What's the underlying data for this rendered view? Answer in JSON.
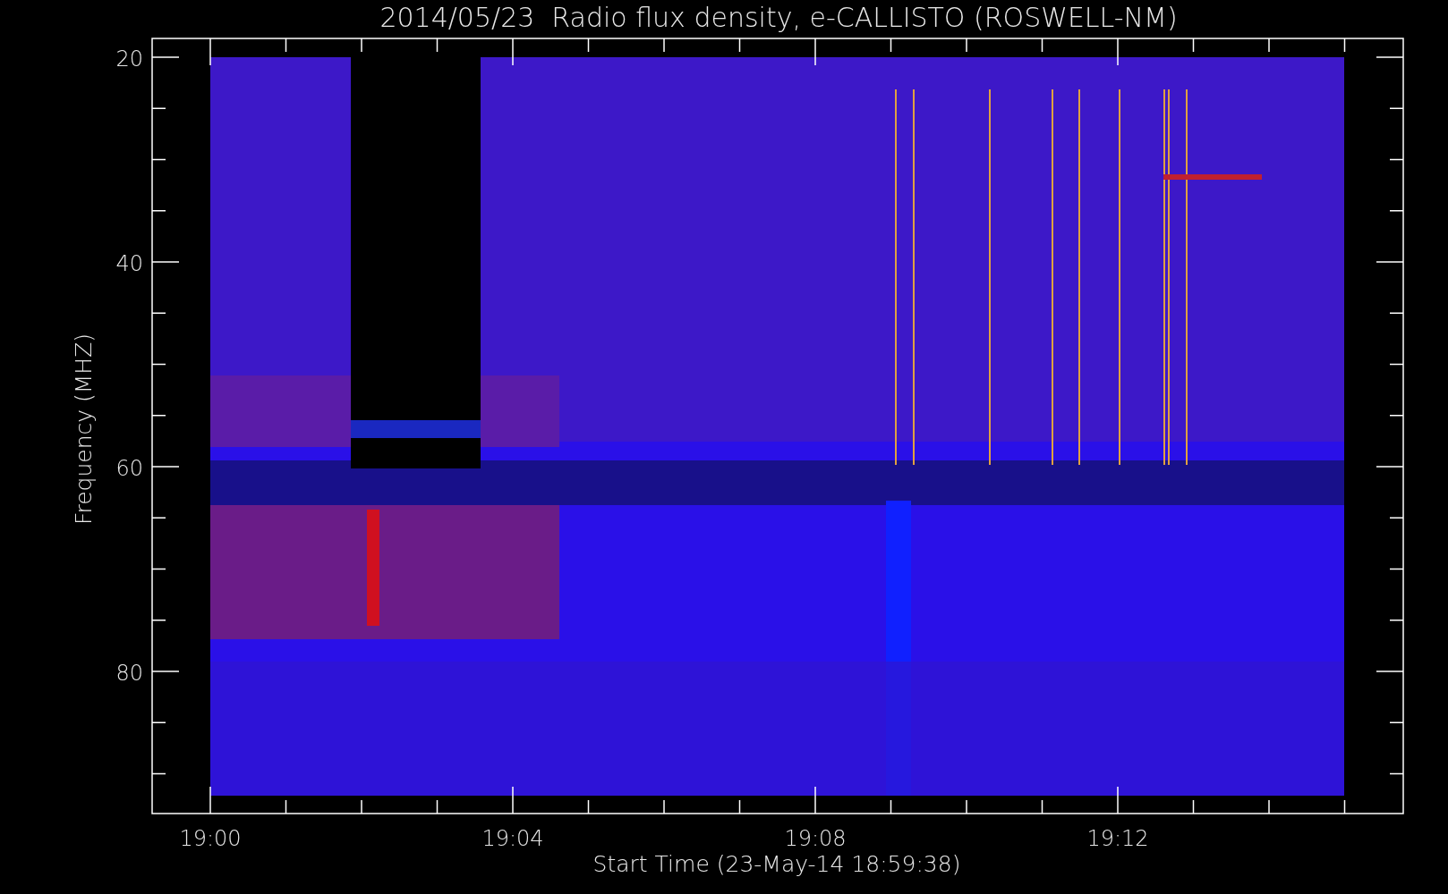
{
  "title": "2014/05/23  Radio flux density, e-CALLISTO (ROSWELL-NM)",
  "y_axis": {
    "label": "Frequency (MHZ)",
    "ticks": [
      "20",
      "40",
      "60",
      "80"
    ]
  },
  "x_axis": {
    "label": "Start Time (23-May-14 18:59:38)",
    "ticks": [
      "19:00",
      "19:04",
      "19:08",
      "19:12"
    ]
  }
}
